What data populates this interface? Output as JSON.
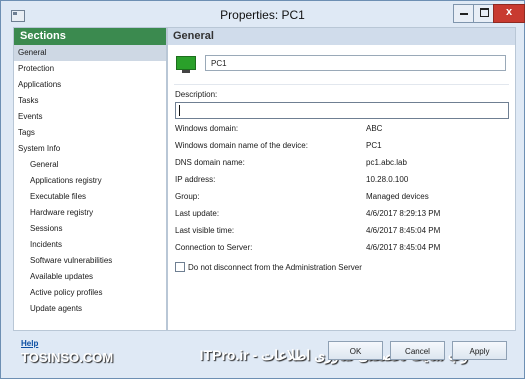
{
  "window": {
    "title": "Properties: PC1",
    "icons": {
      "app": "window-icon",
      "minimize": "minimize-icon",
      "maximize": "maximize-icon",
      "close": "close-icon"
    },
    "close_label": "x"
  },
  "sidebar": {
    "header": "Sections",
    "header_color": "#3b8a4f",
    "items": [
      {
        "label": "General",
        "selected": true
      },
      {
        "label": "Protection"
      },
      {
        "label": "Applications"
      },
      {
        "label": "Tasks"
      },
      {
        "label": "Events"
      },
      {
        "label": "Tags"
      },
      {
        "label": "System Info"
      }
    ],
    "subitems": [
      {
        "label": "General"
      },
      {
        "label": "Applications registry"
      },
      {
        "label": "Executable files"
      },
      {
        "label": "Hardware registry"
      },
      {
        "label": "Sessions"
      },
      {
        "label": "Incidents"
      },
      {
        "label": "Software vulnerabilities"
      },
      {
        "label": "Available updates"
      },
      {
        "label": "Active policy profiles"
      },
      {
        "label": "Update agents"
      }
    ]
  },
  "content": {
    "header": "General",
    "device_icon": "computer-icon",
    "name_value": "PC1",
    "description_label": "Description:",
    "description_value": "",
    "properties": [
      {
        "label": "Windows domain:",
        "value": "ABC"
      },
      {
        "label": "Windows domain name of the device:",
        "value": "PC1"
      },
      {
        "label": "DNS domain name:",
        "value": "pc1.abc.lab"
      },
      {
        "label": "IP address:",
        "value": "10.28.0.100"
      },
      {
        "label": "Group:",
        "value": "Managed devices"
      },
      {
        "label": "Last update:",
        "value": "4/6/2017 8:29:13 PM"
      },
      {
        "label": "Last visible time:",
        "value": "4/6/2017 8:45:04 PM"
      },
      {
        "label": "Connection to Server:",
        "value": "4/6/2017 8:45:04 PM"
      }
    ],
    "checkbox_label": "Do not disconnect from the Administration Server",
    "checkbox_checked": false
  },
  "footer": {
    "help": "Help",
    "ok": "OK",
    "cancel": "Cancel",
    "apply": "Apply"
  },
  "watermark": {
    "left": "TOSINSO.COM",
    "right": "وب سایت تخصصی فناوری اطلاعات - ITPro.ir"
  }
}
